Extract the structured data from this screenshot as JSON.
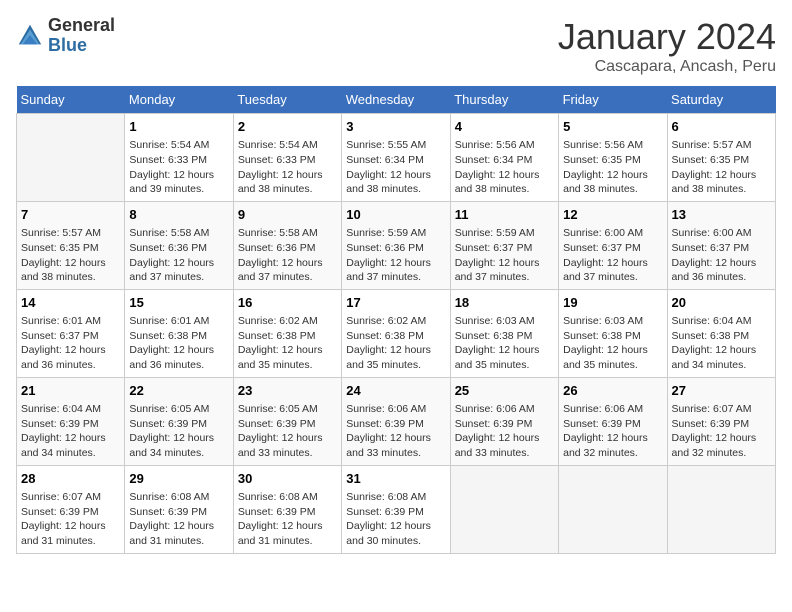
{
  "header": {
    "logo_general": "General",
    "logo_blue": "Blue",
    "month": "January 2024",
    "location": "Cascapara, Ancash, Peru"
  },
  "days_of_week": [
    "Sunday",
    "Monday",
    "Tuesday",
    "Wednesday",
    "Thursday",
    "Friday",
    "Saturday"
  ],
  "weeks": [
    [
      {
        "day": "",
        "info": ""
      },
      {
        "day": "1",
        "info": "Sunrise: 5:54 AM\nSunset: 6:33 PM\nDaylight: 12 hours\nand 39 minutes."
      },
      {
        "day": "2",
        "info": "Sunrise: 5:54 AM\nSunset: 6:33 PM\nDaylight: 12 hours\nand 38 minutes."
      },
      {
        "day": "3",
        "info": "Sunrise: 5:55 AM\nSunset: 6:34 PM\nDaylight: 12 hours\nand 38 minutes."
      },
      {
        "day": "4",
        "info": "Sunrise: 5:56 AM\nSunset: 6:34 PM\nDaylight: 12 hours\nand 38 minutes."
      },
      {
        "day": "5",
        "info": "Sunrise: 5:56 AM\nSunset: 6:35 PM\nDaylight: 12 hours\nand 38 minutes."
      },
      {
        "day": "6",
        "info": "Sunrise: 5:57 AM\nSunset: 6:35 PM\nDaylight: 12 hours\nand 38 minutes."
      }
    ],
    [
      {
        "day": "7",
        "info": "Sunrise: 5:57 AM\nSunset: 6:35 PM\nDaylight: 12 hours\nand 38 minutes."
      },
      {
        "day": "8",
        "info": "Sunrise: 5:58 AM\nSunset: 6:36 PM\nDaylight: 12 hours\nand 37 minutes."
      },
      {
        "day": "9",
        "info": "Sunrise: 5:58 AM\nSunset: 6:36 PM\nDaylight: 12 hours\nand 37 minutes."
      },
      {
        "day": "10",
        "info": "Sunrise: 5:59 AM\nSunset: 6:36 PM\nDaylight: 12 hours\nand 37 minutes."
      },
      {
        "day": "11",
        "info": "Sunrise: 5:59 AM\nSunset: 6:37 PM\nDaylight: 12 hours\nand 37 minutes."
      },
      {
        "day": "12",
        "info": "Sunrise: 6:00 AM\nSunset: 6:37 PM\nDaylight: 12 hours\nand 37 minutes."
      },
      {
        "day": "13",
        "info": "Sunrise: 6:00 AM\nSunset: 6:37 PM\nDaylight: 12 hours\nand 36 minutes."
      }
    ],
    [
      {
        "day": "14",
        "info": "Sunrise: 6:01 AM\nSunset: 6:37 PM\nDaylight: 12 hours\nand 36 minutes."
      },
      {
        "day": "15",
        "info": "Sunrise: 6:01 AM\nSunset: 6:38 PM\nDaylight: 12 hours\nand 36 minutes."
      },
      {
        "day": "16",
        "info": "Sunrise: 6:02 AM\nSunset: 6:38 PM\nDaylight: 12 hours\nand 35 minutes."
      },
      {
        "day": "17",
        "info": "Sunrise: 6:02 AM\nSunset: 6:38 PM\nDaylight: 12 hours\nand 35 minutes."
      },
      {
        "day": "18",
        "info": "Sunrise: 6:03 AM\nSunset: 6:38 PM\nDaylight: 12 hours\nand 35 minutes."
      },
      {
        "day": "19",
        "info": "Sunrise: 6:03 AM\nSunset: 6:38 PM\nDaylight: 12 hours\nand 35 minutes."
      },
      {
        "day": "20",
        "info": "Sunrise: 6:04 AM\nSunset: 6:38 PM\nDaylight: 12 hours\nand 34 minutes."
      }
    ],
    [
      {
        "day": "21",
        "info": "Sunrise: 6:04 AM\nSunset: 6:39 PM\nDaylight: 12 hours\nand 34 minutes."
      },
      {
        "day": "22",
        "info": "Sunrise: 6:05 AM\nSunset: 6:39 PM\nDaylight: 12 hours\nand 34 minutes."
      },
      {
        "day": "23",
        "info": "Sunrise: 6:05 AM\nSunset: 6:39 PM\nDaylight: 12 hours\nand 33 minutes."
      },
      {
        "day": "24",
        "info": "Sunrise: 6:06 AM\nSunset: 6:39 PM\nDaylight: 12 hours\nand 33 minutes."
      },
      {
        "day": "25",
        "info": "Sunrise: 6:06 AM\nSunset: 6:39 PM\nDaylight: 12 hours\nand 33 minutes."
      },
      {
        "day": "26",
        "info": "Sunrise: 6:06 AM\nSunset: 6:39 PM\nDaylight: 12 hours\nand 32 minutes."
      },
      {
        "day": "27",
        "info": "Sunrise: 6:07 AM\nSunset: 6:39 PM\nDaylight: 12 hours\nand 32 minutes."
      }
    ],
    [
      {
        "day": "28",
        "info": "Sunrise: 6:07 AM\nSunset: 6:39 PM\nDaylight: 12 hours\nand 31 minutes."
      },
      {
        "day": "29",
        "info": "Sunrise: 6:08 AM\nSunset: 6:39 PM\nDaylight: 12 hours\nand 31 minutes."
      },
      {
        "day": "30",
        "info": "Sunrise: 6:08 AM\nSunset: 6:39 PM\nDaylight: 12 hours\nand 31 minutes."
      },
      {
        "day": "31",
        "info": "Sunrise: 6:08 AM\nSunset: 6:39 PM\nDaylight: 12 hours\nand 30 minutes."
      },
      {
        "day": "",
        "info": ""
      },
      {
        "day": "",
        "info": ""
      },
      {
        "day": "",
        "info": ""
      }
    ]
  ]
}
